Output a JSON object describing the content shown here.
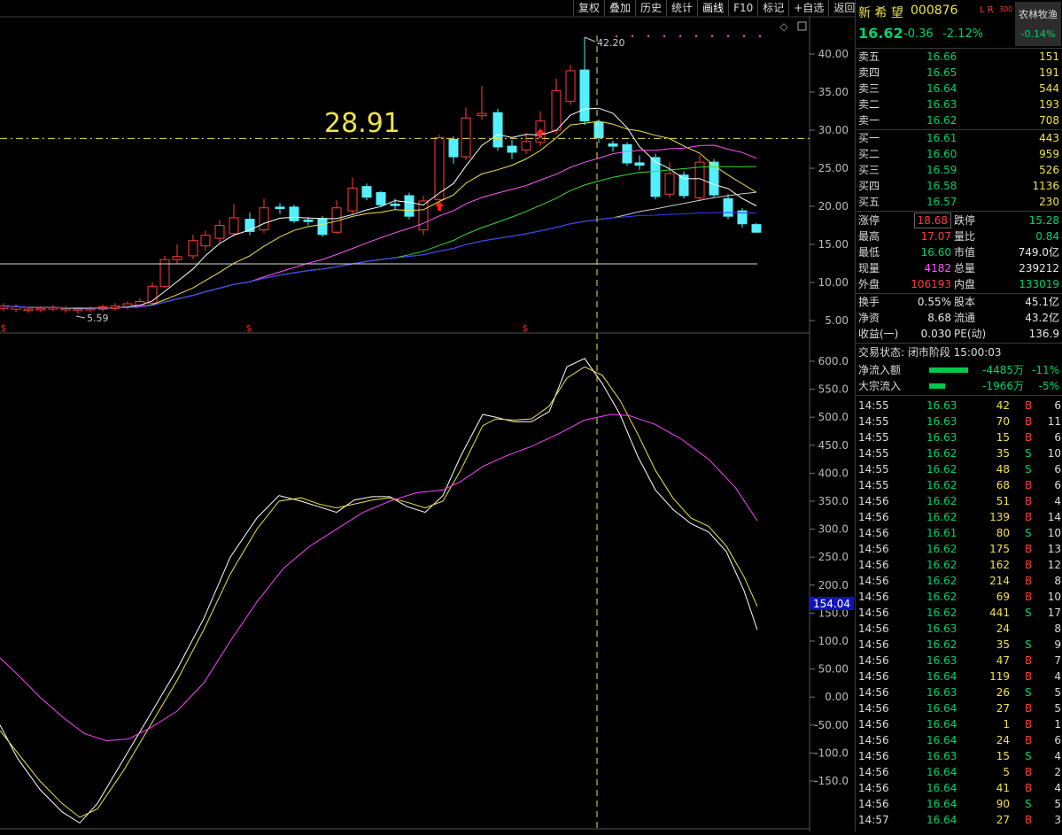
{
  "toolbar": [
    "复权",
    "叠加",
    "历史",
    "统计",
    "画线",
    "F10",
    "标记",
    "+自选",
    "返回"
  ],
  "chart": {
    "price_label": "28.91",
    "high_marker": "42.20",
    "low_marker": "5.59",
    "price_axis": [
      "40.00",
      "35.00",
      "30.00",
      "25.00",
      "20.00",
      "15.00",
      "10.00",
      "5.00"
    ],
    "ind_axis": [
      "600.0",
      "550.0",
      "500.0",
      "450.0",
      "400.0",
      "350.0",
      "300.0",
      "250.0",
      "200.0",
      "150.0",
      "100.0",
      "50.00",
      "0.00",
      "-50.00",
      "-100.0",
      "-150.0"
    ],
    "ind_value": "154.04",
    "colors": {
      "up": "#ff3b3b",
      "down": "#54f0ff",
      "ma5": "#ffffff",
      "ma10": "#f0e44a",
      "ma20": "#ff55ff",
      "ma60": "#33dd33",
      "ma120": "#cccccc",
      "ma250": "#3a3aff",
      "dash": "#f0e44a"
    }
  },
  "quote": {
    "name": "新 希 望",
    "code": "000876",
    "tags": "L R",
    "tag_small": "300",
    "sector": "农林牧渔",
    "sector_change": "-0.14%",
    "price": "16.62",
    "change": "-0.36",
    "change_pct": "-2.12%"
  },
  "asks": [
    {
      "label": "卖五",
      "price": "16.66",
      "vol": "151"
    },
    {
      "label": "卖四",
      "price": "16.65",
      "vol": "191"
    },
    {
      "label": "卖三",
      "price": "16.64",
      "vol": "544"
    },
    {
      "label": "卖二",
      "price": "16.63",
      "vol": "193"
    },
    {
      "label": "卖一",
      "price": "16.62",
      "vol": "708"
    }
  ],
  "bids": [
    {
      "label": "买一",
      "price": "16.61",
      "vol": "443"
    },
    {
      "label": "买二",
      "price": "16.60",
      "vol": "959"
    },
    {
      "label": "买三",
      "price": "16.59",
      "vol": "526"
    },
    {
      "label": "买四",
      "price": "16.58",
      "vol": "1136"
    },
    {
      "label": "买五",
      "price": "16.57",
      "vol": "230"
    }
  ],
  "stats": [
    {
      "l1": "涨停",
      "v1": "18.68",
      "l2": "跌停",
      "v2": "15.28",
      "c1": "red",
      "c2": "green"
    },
    {
      "l1": "最高",
      "v1": "17.07",
      "l2": "量比",
      "v2": "0.84",
      "c1": "red",
      "c2": "green"
    },
    {
      "l1": "最低",
      "v1": "16.60",
      "l2": "市值",
      "v2": "749.0亿",
      "c1": "green",
      "c2": "white"
    },
    {
      "l1": "现量",
      "v1": "4182",
      "l2": "总量",
      "v2": "239212",
      "c1": "magenta",
      "c2": "white"
    },
    {
      "l1": "外盘",
      "v1": "106193",
      "l2": "内盘",
      "v2": "133019",
      "c1": "red",
      "c2": "green"
    },
    {
      "l1": "换手",
      "v1": "0.55%",
      "l2": "股本",
      "v2": "45.1亿",
      "c1": "white",
      "c2": "white"
    },
    {
      "l1": "净资",
      "v1": "8.68",
      "l2": "流通",
      "v2": "43.2亿",
      "c1": "white",
      "c2": "white"
    },
    {
      "l1": "收益(一)",
      "v1": "0.030",
      "l2": "PE(动)",
      "v2": "136.9",
      "c1": "white",
      "c2": "white"
    }
  ],
  "trade_status": "交易状态: 闭市阶段 15:00:03",
  "flows": [
    {
      "label": "净流入额",
      "value": "-4485万",
      "pct": "-11%"
    },
    {
      "label": "大宗流入",
      "value": "-1966万",
      "pct": "-5%"
    }
  ],
  "ticks": [
    [
      "14:55",
      "16.63",
      "42",
      "B",
      "6"
    ],
    [
      "14:55",
      "16.63",
      "70",
      "B",
      "11"
    ],
    [
      "14:55",
      "16.63",
      "15",
      "B",
      "6"
    ],
    [
      "14:55",
      "16.62",
      "35",
      "S",
      "10"
    ],
    [
      "14:55",
      "16.62",
      "48",
      "S",
      "6"
    ],
    [
      "14:55",
      "16.62",
      "68",
      "B",
      "6"
    ],
    [
      "14:56",
      "16.62",
      "51",
      "B",
      "4"
    ],
    [
      "14:56",
      "16.62",
      "139",
      "B",
      "14"
    ],
    [
      "14:56",
      "16.61",
      "80",
      "S",
      "10"
    ],
    [
      "14:56",
      "16.62",
      "175",
      "B",
      "13"
    ],
    [
      "14:56",
      "16.62",
      "162",
      "B",
      "12"
    ],
    [
      "14:56",
      "16.62",
      "214",
      "B",
      "8"
    ],
    [
      "14:56",
      "16.62",
      "69",
      "B",
      "10"
    ],
    [
      "14:56",
      "16.62",
      "441",
      "S",
      "17"
    ],
    [
      "14:56",
      "16.63",
      "24",
      "",
      "8"
    ],
    [
      "14:56",
      "16.62",
      "35",
      "S",
      "9"
    ],
    [
      "14:56",
      "16.63",
      "47",
      "B",
      "7"
    ],
    [
      "14:56",
      "16.64",
      "119",
      "B",
      "4"
    ],
    [
      "14:56",
      "16.63",
      "26",
      "S",
      "5"
    ],
    [
      "14:56",
      "16.64",
      "27",
      "B",
      "5"
    ],
    [
      "14:56",
      "16.64",
      "1",
      "B",
      "1"
    ],
    [
      "14:56",
      "16.64",
      "24",
      "B",
      "6"
    ],
    [
      "14:56",
      "16.63",
      "15",
      "S",
      "4"
    ],
    [
      "14:56",
      "16.64",
      "5",
      "B",
      "2"
    ],
    [
      "14:56",
      "16.64",
      "41",
      "B",
      "4"
    ],
    [
      "14:56",
      "16.64",
      "90",
      "S",
      "5"
    ],
    [
      "14:57",
      "16.64",
      "27",
      "B",
      "3"
    ]
  ]
}
